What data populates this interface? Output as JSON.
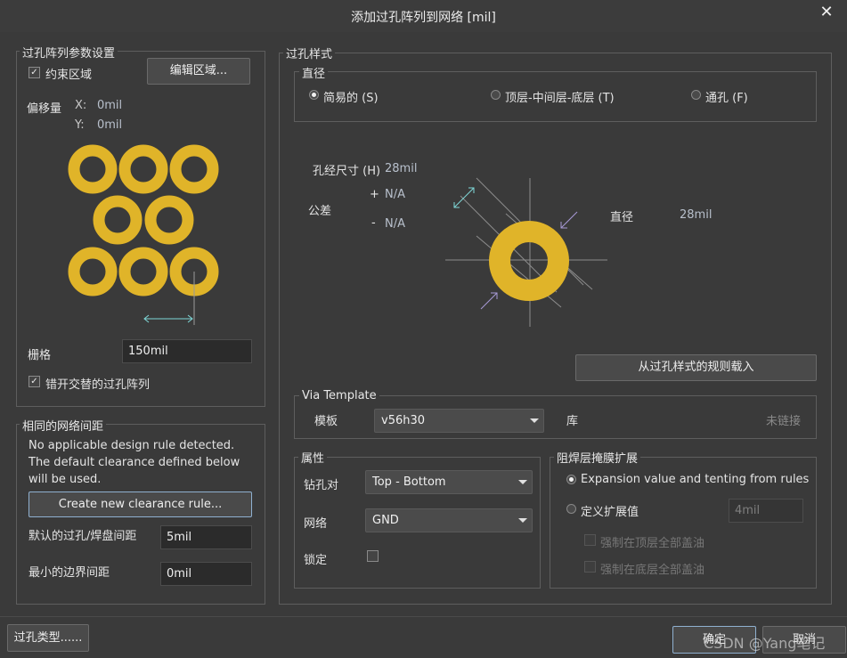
{
  "window": {
    "title": "添加过孔阵列到网络 [mil]",
    "close_glyph": "✕"
  },
  "params": {
    "group_label": "过孔阵列参数设置",
    "constrain_label": "约束区域",
    "constrain_checked": true,
    "edit_region_button": "编辑区域...",
    "offset_label": "偏移量",
    "offset_x_label": "X:",
    "offset_x_value": "0mil",
    "offset_y_label": "Y:",
    "offset_y_value": "0mil",
    "grid_label": "栅格",
    "grid_value": "150mil",
    "stagger_label": "错开交替的过孔阵列",
    "stagger_checked": true
  },
  "clearance": {
    "group_label": "相同的网络间距",
    "message_line1": "No applicable design rule detected.",
    "message_line2": "The default clearance defined below",
    "message_line3": "will be used.",
    "create_rule_button": "Create new clearance rule...",
    "default_label": "默认的过孔/焊盘间距",
    "default_value": "5mil",
    "min_label": "最小的边界间距",
    "min_value": "0mil"
  },
  "via_style": {
    "group_label": "过孔样式",
    "diameter_group_label": "直径",
    "options": [
      {
        "label": "简易的 (S)",
        "selected": true
      },
      {
        "label": "顶层-中间层-底层 (T)",
        "selected": false
      },
      {
        "label": "通孔 (F)",
        "selected": false
      }
    ],
    "hole_size_label": "孔经尺寸 (H)",
    "hole_size_value": "28mil",
    "tolerance_label": "公差",
    "tol_plus_sign": "+",
    "tol_plus_value": "N/A",
    "tol_minus_sign": "-",
    "tol_minus_value": "N/A",
    "diameter_label": "直径",
    "diameter_value": "28mil",
    "load_rules_button": "从过孔样式的规则载入",
    "via_color": "#e0b429"
  },
  "template": {
    "group_label": "Via Template",
    "template_label": "模板",
    "template_value": "v56h30",
    "library_label": "库",
    "library_status": "未链接"
  },
  "properties": {
    "group_label": "属性",
    "drill_pair_label": "钻孔对",
    "drill_pair_value": "Top - Bottom",
    "net_label": "网络",
    "net_value": "GND",
    "lock_label": "锁定",
    "lock_checked": false
  },
  "solder_mask": {
    "group_label": "阻焊层掩膜扩展",
    "option_rules": "Expansion value and tenting from rules",
    "option_rules_selected": true,
    "option_custom": "定义扩展值",
    "option_custom_selected": false,
    "custom_value": "4mil",
    "force_top_label": "强制在顶层全部盖油",
    "force_bottom_label": "强制在底层全部盖油"
  },
  "footer": {
    "via_type_button": "过孔类型......",
    "ok_button": "确定",
    "cancel_button": "取消",
    "watermark": "CSDN @Yang笔记"
  }
}
